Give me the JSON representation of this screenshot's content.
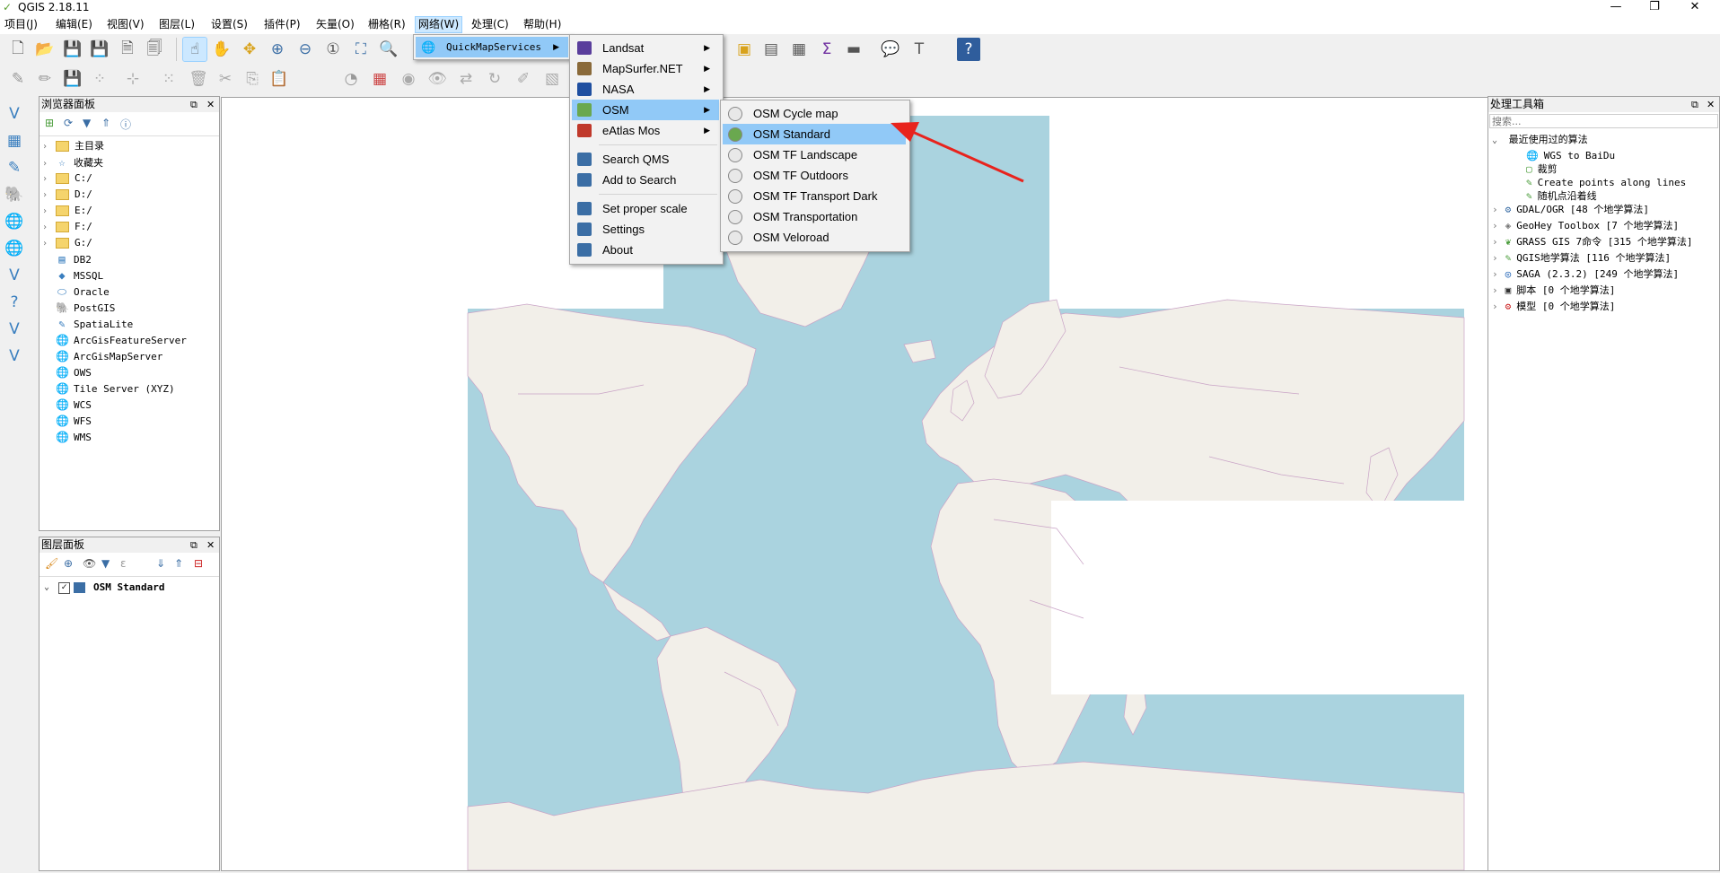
{
  "window": {
    "title": "QGIS 2.18.11",
    "minimize": "—",
    "restore": "❐",
    "close": "✕"
  },
  "menubar": [
    "项目(J)",
    "编辑(E)",
    "视图(V)",
    "图层(L)",
    "设置(S)",
    "插件(P)",
    "矢量(O)",
    "栅格(R)",
    "网络(W)",
    "处理(C)",
    "帮助(H)"
  ],
  "web_menu": {
    "item": "QuickMapServices"
  },
  "qms_menu": {
    "items": [
      {
        "label": "Landsat",
        "submenu": true
      },
      {
        "label": "MapSurfer.NET",
        "submenu": true
      },
      {
        "label": "NASA",
        "submenu": true
      },
      {
        "label": "OSM",
        "submenu": true
      },
      {
        "label": "eAtlas Mos",
        "submenu": true
      }
    ],
    "actions": [
      "Search QMS",
      "Add to Search"
    ],
    "actions2": [
      "Set proper scale",
      "Settings",
      "About"
    ]
  },
  "osm_menu": {
    "items": [
      "OSM Cycle map",
      "OSM Standard",
      "OSM TF Landscape",
      "OSM TF Outdoors",
      "OSM TF Transport Dark",
      "OSM Transportation",
      "OSM Veloroad"
    ],
    "selected": "OSM Standard"
  },
  "browser_panel": {
    "title": "浏览器面板",
    "items": [
      {
        "label": "主目录",
        "icon": "folder-icon",
        "expand": true
      },
      {
        "label": "收藏夹",
        "icon": "star-icon",
        "expand": true
      },
      {
        "label": "C:/",
        "icon": "folder-icon",
        "expand": true
      },
      {
        "label": "D:/",
        "icon": "folder-icon",
        "expand": true
      },
      {
        "label": "E:/",
        "icon": "folder-icon",
        "expand": true
      },
      {
        "label": "F:/",
        "icon": "folder-icon",
        "expand": true
      },
      {
        "label": "G:/",
        "icon": "folder-icon",
        "expand": true
      },
      {
        "label": "DB2",
        "icon": "db2-icon",
        "expand": false
      },
      {
        "label": "MSSQL",
        "icon": "mssql-icon",
        "expand": false
      },
      {
        "label": "Oracle",
        "icon": "oracle-icon",
        "expand": false
      },
      {
        "label": "PostGIS",
        "icon": "postgis-icon",
        "expand": false
      },
      {
        "label": "SpatiaLite",
        "icon": "spatialite-icon",
        "expand": false
      },
      {
        "label": "ArcGisFeatureServer",
        "icon": "globe-icon",
        "expand": false
      },
      {
        "label": "ArcGisMapServer",
        "icon": "globe-icon",
        "expand": false
      },
      {
        "label": "OWS",
        "icon": "globe-icon",
        "expand": false
      },
      {
        "label": "Tile Server (XYZ)",
        "icon": "globe-icon",
        "expand": false
      },
      {
        "label": "WCS",
        "icon": "globe-icon",
        "expand": false
      },
      {
        "label": "WFS",
        "icon": "globe-icon",
        "expand": false
      },
      {
        "label": "WMS",
        "icon": "globe-icon",
        "expand": false
      }
    ]
  },
  "layers_panel": {
    "title": "图层面板",
    "layers": [
      {
        "name": "OSM Standard",
        "checked": true
      }
    ]
  },
  "processing_panel": {
    "title": "处理工具箱",
    "search_placeholder": "搜索...",
    "recent_group": "最近使用过的算法",
    "recent": [
      "WGS to BaiDu",
      "裁剪",
      "Create points along lines",
      "随机点沿着线"
    ],
    "providers": [
      "GDAL/OGR [48 个地学算法]",
      "GeoHey Toolbox [7 个地学算法]",
      "GRASS GIS 7命令 [315 个地学算法]",
      "QGIS地学算法 [116 个地学算法]",
      "SAGA (2.3.2) [249 个地学算法]",
      "脚本 [0 个地学算法]",
      "模型 [0 个地学算法]"
    ]
  },
  "colors": {
    "water": "#aad3df",
    "land": "#f2efe9",
    "border": "#c9a3c6",
    "highlight": "#91c9f7",
    "annotation": "#e8231d"
  }
}
